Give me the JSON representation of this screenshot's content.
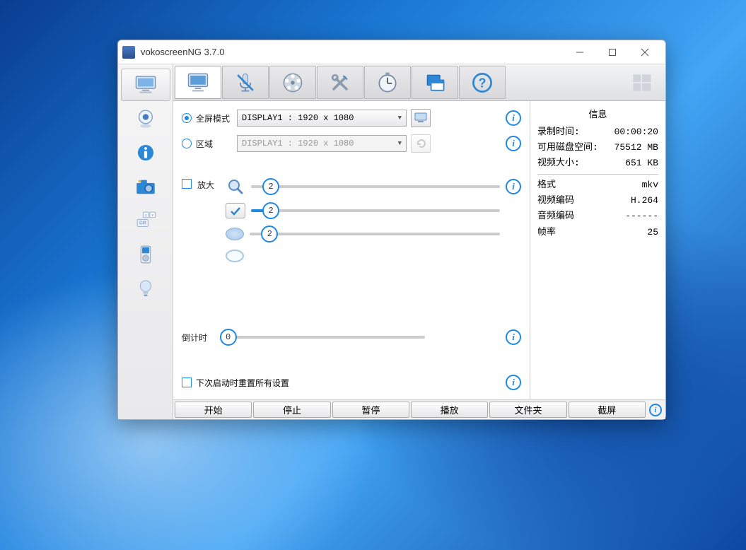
{
  "window": {
    "title": "vokoscreenNG 3.7.0"
  },
  "settings": {
    "fullscreen_label": "全屏模式",
    "fullscreen_value": "DISPLAY1 :  1920 x 1080",
    "area_label": "区域",
    "area_value": "DISPLAY1 :  1920 x 1080",
    "magnify_label": "放大",
    "countdown_label": "倒计时",
    "reset_label": "下次启动时重置所有设置",
    "slider1_value": "2",
    "slider2_value": "2",
    "slider3_value": "2",
    "countdown_value": "0"
  },
  "info": {
    "title": "信息",
    "rows1": [
      {
        "key": "录制时间:",
        "val": "00:00:20"
      },
      {
        "key": "可用磁盘空间:",
        "val": "75512 MB"
      },
      {
        "key": "视频大小:",
        "val": "651 KB"
      }
    ],
    "rows2": [
      {
        "key": "格式",
        "val": "mkv"
      },
      {
        "key": "视频编码",
        "val": "H.264"
      },
      {
        "key": "音频编码",
        "val": "------"
      },
      {
        "key": "帧率",
        "val": "25"
      }
    ]
  },
  "buttons": {
    "start": "开始",
    "stop": "停止",
    "pause": "暂停",
    "play": "播放",
    "folder": "文件夹",
    "screenshot": "截屏"
  }
}
